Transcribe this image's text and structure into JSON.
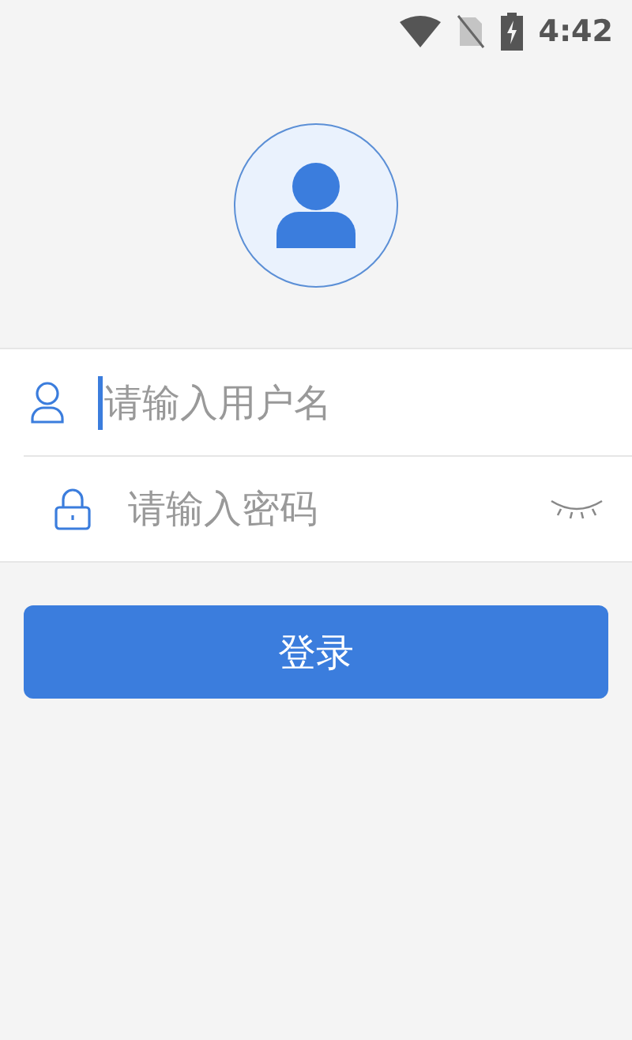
{
  "status_bar": {
    "time": "4:42"
  },
  "fields": [
    {
      "kind": "username",
      "placeholder": "请输入用户名",
      "focused": true
    },
    {
      "kind": "password",
      "placeholder": "请输入密码",
      "focused": false
    }
  ],
  "login_button": {
    "label": "登录"
  }
}
